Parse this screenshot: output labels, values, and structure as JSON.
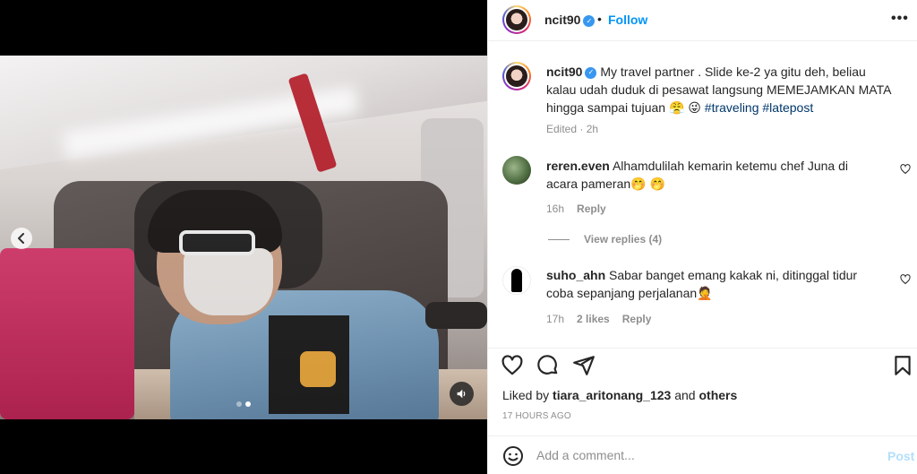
{
  "header": {
    "username": "ncit90",
    "separator": "•",
    "follow_label": "Follow",
    "more_label": "•••"
  },
  "caption": {
    "username": "ncit90",
    "text": " My travel partner . Slide ke-2 ya gitu deh, beliau kalau udah duduk di pesawat langsung MEMEJAMKAN MATA hingga sampai tujuan 😤 😜 ",
    "hashtags": "#traveling #latepost",
    "edited": "Edited",
    "time": "2h"
  },
  "comments": [
    {
      "username": "reren.even",
      "text": " Alhamdulilah kemarin ketemu chef Juna di acara pameran🤭 🤭",
      "time": "16h",
      "reply_label": "Reply",
      "view_replies": "View replies (4)"
    },
    {
      "username": "suho_ahn",
      "text": " Sabar banget emang kakak ni, ditinggal tidur coba sepanjang perjalanan🤦",
      "time": "17h",
      "likes": "2 likes",
      "reply_label": "Reply"
    }
  ],
  "likes": {
    "prefix": "Liked by ",
    "user": "tiara_aritonang_123",
    "connector": " and ",
    "others": "others"
  },
  "timestamp": "17 HOURS AGO",
  "add_comment": {
    "placeholder": "Add a comment...",
    "post_label": "Post"
  },
  "media": {
    "prev_icon": "chevron-left-icon",
    "mute_icon": "volume-icon",
    "slide_count": 2,
    "active_slide": 2
  },
  "colors": {
    "accent": "#0095f6",
    "post_disabled": "#b2dffc",
    "muted_text": "#8e8e8e",
    "hashtag": "#00376b"
  }
}
